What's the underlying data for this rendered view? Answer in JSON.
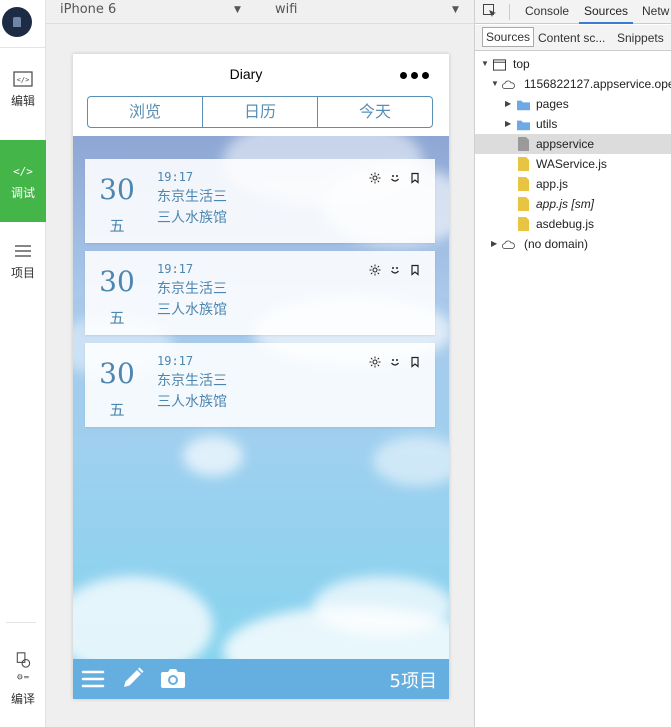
{
  "ide": {
    "nav": [
      {
        "label": "编辑",
        "icon": "code-window-icon"
      },
      {
        "label": "调试",
        "icon": "code-brackets-icon"
      },
      {
        "label": "项目",
        "icon": "menu-lines-icon"
      },
      {
        "label": "编译",
        "icon": "compile-icon"
      }
    ],
    "accent": "#44b549"
  },
  "simulator": {
    "device": "iPhone 6",
    "network": "wifi"
  },
  "app": {
    "title": "Diary",
    "tabs": [
      "浏览",
      "日历",
      "今天"
    ],
    "entries": [
      {
        "day": "30",
        "weekday": "五",
        "time": "19:17",
        "line1": "东京生活三",
        "line2": "三人水族馆"
      },
      {
        "day": "30",
        "weekday": "五",
        "time": "19:17",
        "line1": "东京生活三",
        "line2": "三人水族馆"
      },
      {
        "day": "30",
        "weekday": "五",
        "time": "19:17",
        "line1": "东京生活三",
        "line2": "三人水族馆"
      }
    ],
    "item_count": "5项目",
    "colors": {
      "text": "#4d86b0",
      "bar": "#65aee0"
    }
  },
  "devtools": {
    "tabs": [
      "Console",
      "Sources",
      "Netw"
    ],
    "active_tab": "Sources",
    "sub_tabs": [
      "Sources",
      "Content sc...",
      "Snippets"
    ],
    "tree": {
      "top": "top",
      "origin": "1156822127.appservice.ope",
      "items": [
        "pages",
        "utils",
        "appservice",
        "WAService.js",
        "app.js",
        "app.js [sm]",
        "asdebug.js"
      ],
      "no_domain": "(no domain)"
    }
  }
}
